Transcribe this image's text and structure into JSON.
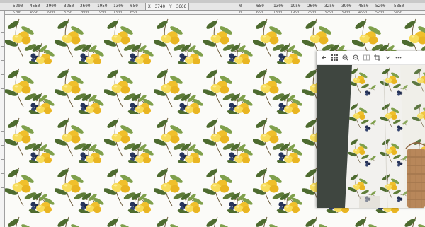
{
  "ruler_row": {
    "ticks": [
      "5200",
      "4550",
      "3900",
      "3250",
      "2600",
      "1950",
      "1300",
      "650",
      "0",
      "650",
      "1300",
      "1950",
      "2600",
      "3250",
      "3900",
      "4550",
      "5200",
      "5850"
    ],
    "coord_x_label": "X",
    "coord_x_value": "3740",
    "coord_y_label": "Y",
    "coord_y_value": "3666"
  },
  "h_ruler": {
    "ticks": [
      "5200",
      "4550",
      "3900",
      "3250",
      "2600",
      "1950",
      "1300",
      "650",
      "0",
      "650",
      "1300",
      "1950",
      "2600",
      "3250",
      "3900",
      "4550",
      "5200",
      "5850"
    ]
  },
  "preview": {
    "toolbar_icons": [
      "back-arrow-icon",
      "grid-icon",
      "zoom-in-icon",
      "zoom-out-icon",
      "split-icon",
      "crop-icon",
      "chevron-down-icon",
      "more-icon"
    ]
  },
  "colors": {
    "lemon": "#f0c02c",
    "lemon_light": "#f7dc5a",
    "leaf": "#4d6b2f",
    "leaf_light": "#7fa04c",
    "berry": "#27345a",
    "background": "#fbfbf8",
    "dress_white": "#f2f1ee",
    "basket": "#b8875a"
  }
}
